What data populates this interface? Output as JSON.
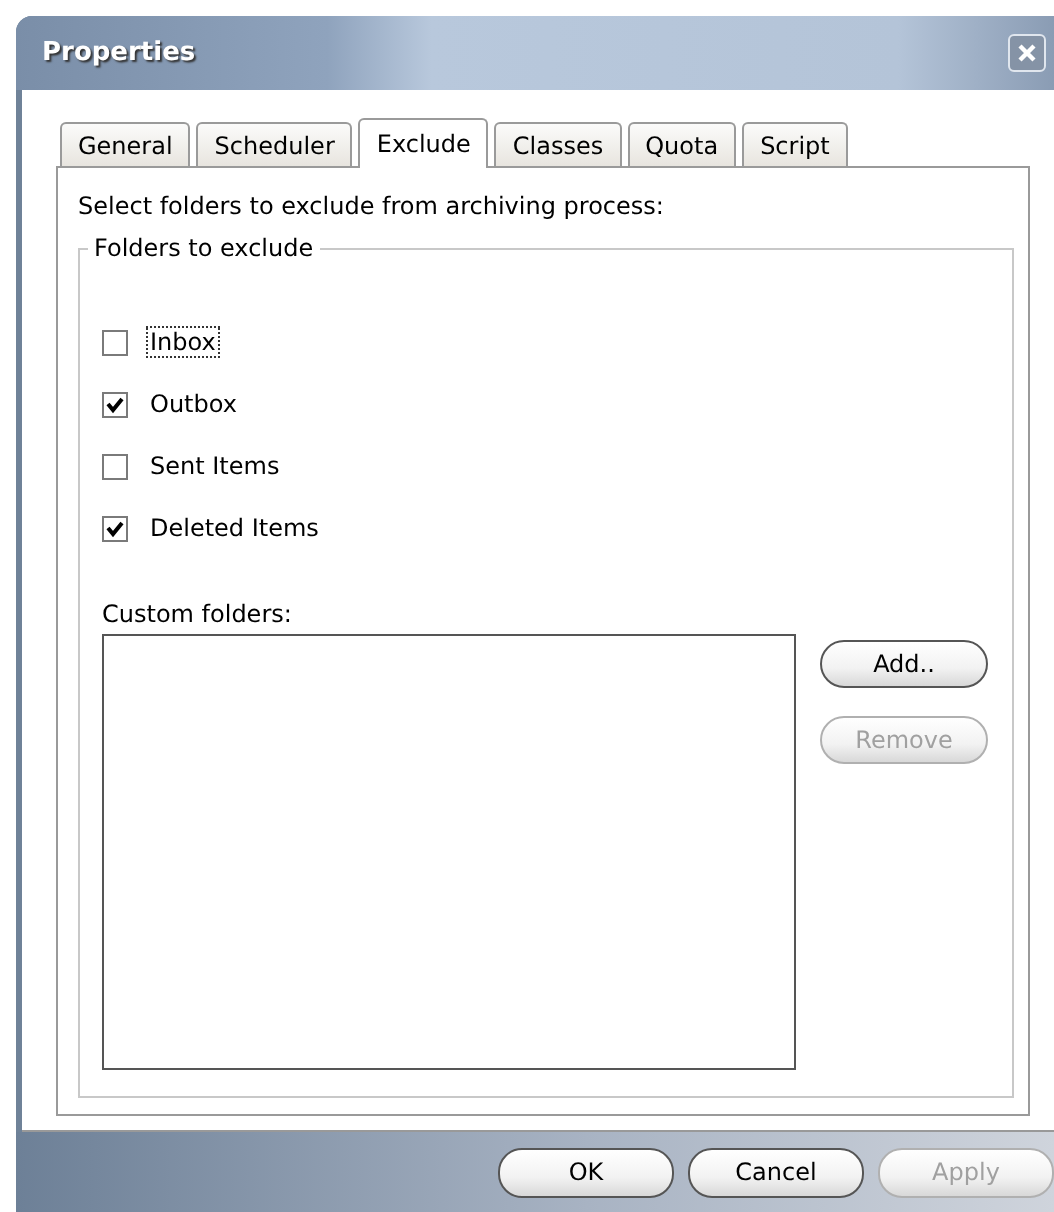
{
  "window": {
    "title": "Properties"
  },
  "tabs": [
    {
      "label": "General",
      "selected": false
    },
    {
      "label": "Scheduler",
      "selected": false
    },
    {
      "label": "Exclude",
      "selected": true
    },
    {
      "label": "Classes",
      "selected": false
    },
    {
      "label": "Quota",
      "selected": false
    },
    {
      "label": "Script",
      "selected": false
    }
  ],
  "instruction": "Select folders to exclude from archiving process:",
  "group": {
    "title": "Folders to exclude",
    "folders": [
      {
        "label": "Inbox",
        "checked": false,
        "focused": true
      },
      {
        "label": "Outbox",
        "checked": true,
        "focused": false
      },
      {
        "label": "Sent Items",
        "checked": false,
        "focused": false
      },
      {
        "label": "Deleted Items",
        "checked": true,
        "focused": false
      }
    ],
    "custom_label": "Custom folders:",
    "side_buttons": [
      {
        "label": "Add..",
        "disabled": false
      },
      {
        "label": "Remove",
        "disabled": true
      }
    ]
  },
  "buttons": [
    {
      "label": "OK",
      "disabled": false
    },
    {
      "label": "Cancel",
      "disabled": false
    },
    {
      "label": "Apply",
      "disabled": true
    }
  ]
}
